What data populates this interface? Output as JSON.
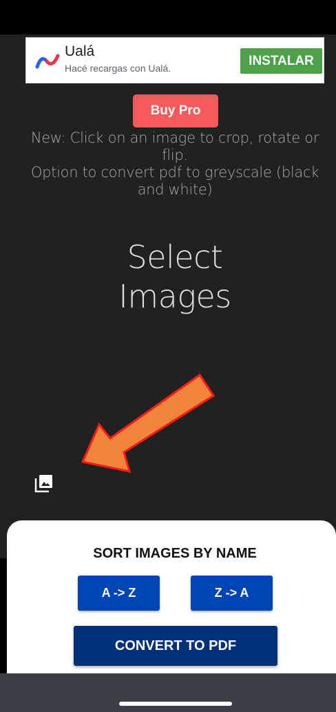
{
  "ad": {
    "title": "Ualá",
    "subtitle": "Hacé recargas con Ualá.",
    "install_label": "INSTALAR",
    "install_color": "#4ba148",
    "logo_icon": "uala-logo-icon"
  },
  "header": {
    "buy_pro_label": "Buy Pro",
    "buy_pro_color": "#f65a5a"
  },
  "notes": {
    "line1": "New: Click on an image to crop, rotate or",
    "line2": "flip.",
    "line3": "Option to convert pdf to greyscale (black",
    "line4": "and white)"
  },
  "main": {
    "select_line1": "Select",
    "select_line2": "Images",
    "gallery_icon": "photo-library-icon",
    "arrow_color": "#f0853a"
  },
  "sheet": {
    "sort_title": "SORT IMAGES BY NAME",
    "az_label": "A -> Z",
    "za_label": "Z -> A",
    "convert_label": "CONVERT TO PDF",
    "sort_button_color": "#0045b5",
    "convert_button_color": "#003178"
  }
}
